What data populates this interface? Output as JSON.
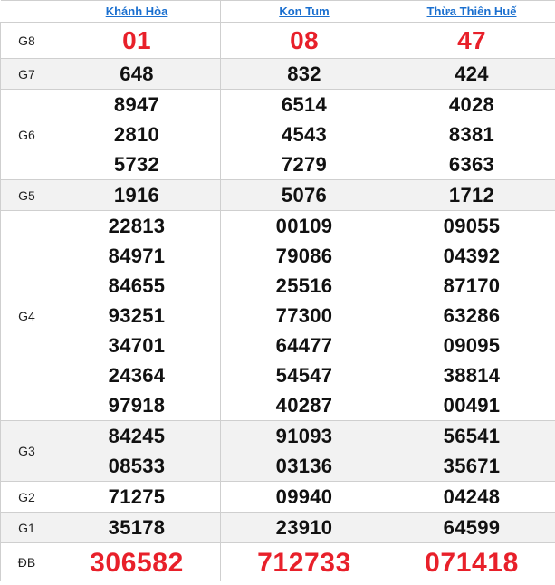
{
  "provinces": [
    "Khánh Hòa",
    "Kon Tum",
    "Thừa Thiên Huế"
  ],
  "prizes": [
    {
      "label": "G8",
      "values": [
        [
          "01"
        ],
        [
          "08"
        ],
        [
          "47"
        ]
      ]
    },
    {
      "label": "G7",
      "values": [
        [
          "648"
        ],
        [
          "832"
        ],
        [
          "424"
        ]
      ]
    },
    {
      "label": "G6",
      "values": [
        [
          "8947",
          "2810",
          "5732"
        ],
        [
          "6514",
          "4543",
          "7279"
        ],
        [
          "4028",
          "8381",
          "6363"
        ]
      ]
    },
    {
      "label": "G5",
      "values": [
        [
          "1916"
        ],
        [
          "5076"
        ],
        [
          "1712"
        ]
      ]
    },
    {
      "label": "G4",
      "values": [
        [
          "22813",
          "84971",
          "84655",
          "93251",
          "34701",
          "24364",
          "97918"
        ],
        [
          "00109",
          "79086",
          "25516",
          "77300",
          "64477",
          "54547",
          "40287"
        ],
        [
          "09055",
          "04392",
          "87170",
          "63286",
          "09095",
          "38814",
          "00491"
        ]
      ]
    },
    {
      "label": "G3",
      "values": [
        [
          "84245",
          "08533"
        ],
        [
          "91093",
          "03136"
        ],
        [
          "56541",
          "35671"
        ]
      ]
    },
    {
      "label": "G2",
      "values": [
        [
          "71275"
        ],
        [
          "09940"
        ],
        [
          "04248"
        ]
      ]
    },
    {
      "label": "G1",
      "values": [
        [
          "35178"
        ],
        [
          "23910"
        ],
        [
          "64599"
        ]
      ]
    },
    {
      "label": "ĐB",
      "values": [
        [
          "306582"
        ],
        [
          "712733"
        ],
        [
          "071418"
        ]
      ]
    }
  ],
  "colors": {
    "link": "#1a6fcf",
    "highlight": "#e8202a",
    "alt_row": "#f2f2f2",
    "border": "#cfcfcf"
  }
}
